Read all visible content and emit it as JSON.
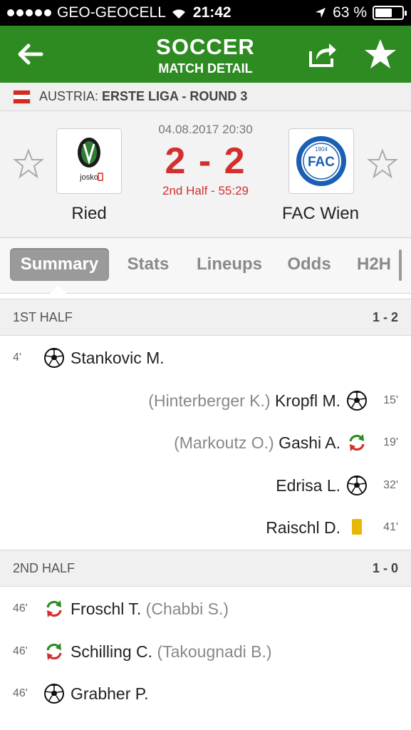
{
  "statusbar": {
    "carrier": "GEO-GEOCELL",
    "time": "21:42",
    "battery": "63 %",
    "battery_level": 0.63
  },
  "header": {
    "title": "SOCCER",
    "subtitle": "MATCH DETAIL"
  },
  "league": {
    "country": "AUSTRIA:",
    "name": "ERSTE LIGA - ROUND 3",
    "flag_colors": [
      "#d52b1e",
      "#ffffff",
      "#d52b1e"
    ]
  },
  "match": {
    "datetime": "04.08.2017 20:30",
    "score": "2 - 2",
    "status": "2nd Half - 55:29",
    "home": {
      "name": "Ried",
      "crest_text": "josko"
    },
    "away": {
      "name": "FAC Wien",
      "crest_text": "FAC",
      "crest_year": "1904",
      "crest_ring": "FLORIDSDORFER ATHLETIKSPORT-CLUB"
    }
  },
  "tabs": [
    "Summary",
    "Stats",
    "Lineups",
    "Odds",
    "H2H"
  ],
  "active_tab": "Summary",
  "halves": [
    {
      "label": "1ST HALF",
      "score": "1 - 2"
    },
    {
      "label": "2ND HALF",
      "score": "1 - 0"
    }
  ],
  "events": {
    "first_half": [
      {
        "minute": "4'",
        "side": "home",
        "type": "goal-icon",
        "player": "Stankovic M.",
        "detail": ""
      },
      {
        "minute": "15'",
        "side": "away",
        "type": "goal-icon",
        "player": "Kropfl M.",
        "detail": "(Hinterberger K.)"
      },
      {
        "minute": "19'",
        "side": "away",
        "type": "substitution-icon",
        "player": "Gashi A.",
        "detail": "(Markoutz O.)"
      },
      {
        "minute": "32'",
        "side": "away",
        "type": "goal-icon",
        "player": "Edrisa L.",
        "detail": ""
      },
      {
        "minute": "41'",
        "side": "away",
        "type": "yellow-card-icon",
        "player": "Raischl D.",
        "detail": ""
      }
    ],
    "second_half": [
      {
        "minute": "46'",
        "side": "home",
        "type": "substitution-icon",
        "player": "Froschl T.",
        "detail": "(Chabbi S.)"
      },
      {
        "minute": "46'",
        "side": "home",
        "type": "substitution-icon",
        "player": "Schilling C.",
        "detail": "(Takougnadi B.)"
      },
      {
        "minute": "46'",
        "side": "home",
        "type": "goal-icon",
        "player": "Grabher P.",
        "detail": ""
      }
    ]
  },
  "colors": {
    "brand_green": "#2e8b22",
    "score_red": "#d32f2f",
    "yellow_card": "#e6b800",
    "sub_green": "#2e8b22",
    "sub_red": "#d32f2f"
  }
}
